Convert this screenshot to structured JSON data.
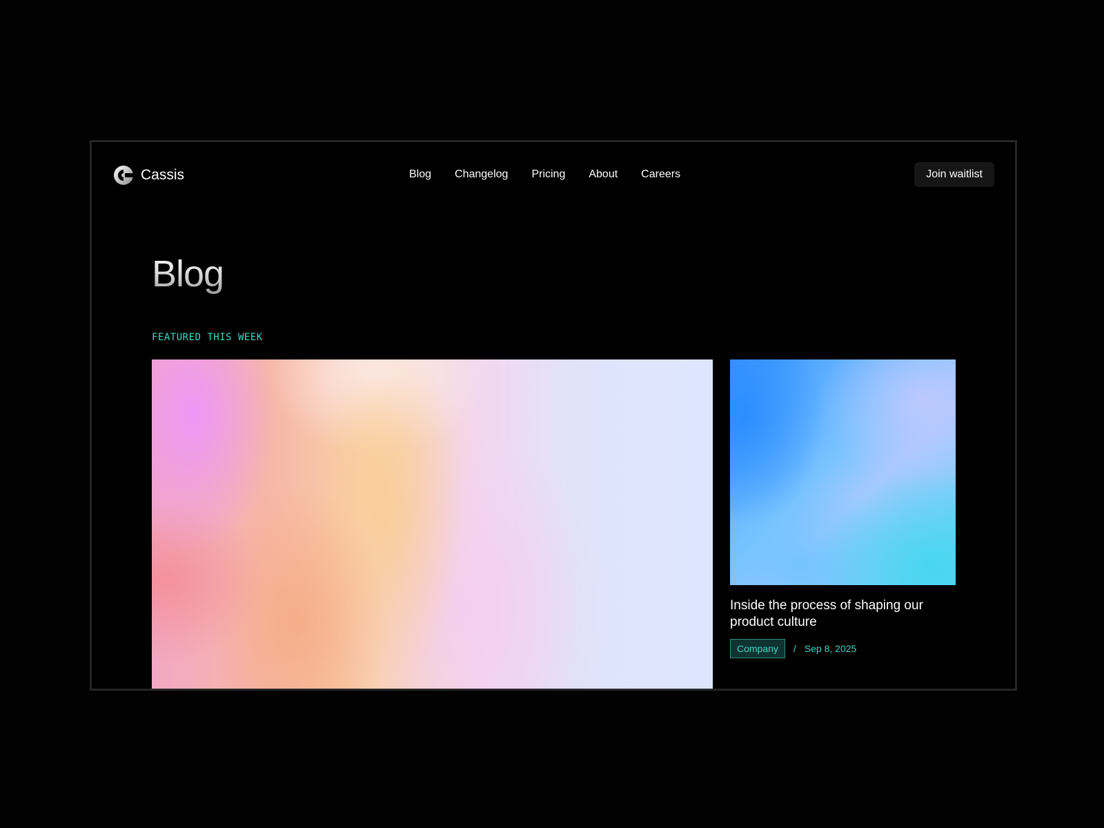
{
  "brand": {
    "name": "Cassis",
    "logo_icon": "cassis-logo-icon"
  },
  "nav": {
    "links": [
      "Blog",
      "Changelog",
      "Pricing",
      "About",
      "Careers"
    ],
    "cta_label": "Join waitlist"
  },
  "main": {
    "title": "Blog",
    "section_label": "FEATURED THIS WEEK",
    "featured_post": {
      "image": "gradient-pink-peach-lavender"
    },
    "side_post": {
      "image": "gradient-blue-cyan",
      "title": "Inside the process of shaping our product culture",
      "tag": "Company",
      "separator": "/",
      "date": "Sep 8, 2025"
    }
  },
  "colors": {
    "background": "#000000",
    "accent": "#3dd6c6",
    "text": "#ffffff",
    "cta_background": "#161616",
    "frame_border": "#262626"
  }
}
